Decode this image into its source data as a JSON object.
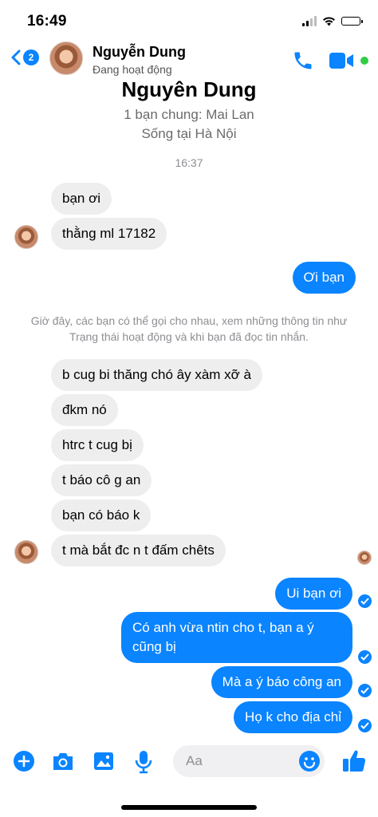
{
  "status_bar": {
    "time": "16:49"
  },
  "header": {
    "back_badge": "2",
    "name": "Nguyễn Dung",
    "status": "Đang hoạt động",
    "colors": {
      "accent": "#0a84ff",
      "online": "#31cc46"
    },
    "icons": [
      "back-chevron-icon",
      "phone-icon",
      "video-camera-icon"
    ]
  },
  "intro": {
    "name": "Nguyên Dung",
    "mutual": "1 bạn chung: Mai Lan",
    "location": "Sống tại Hà Nội"
  },
  "timestamp": "16:37",
  "messages_block1": [
    {
      "from": "them",
      "text": "bạn ơi"
    },
    {
      "from": "them",
      "text": "thằng ml 17182"
    },
    {
      "from": "me",
      "text": "Ơi bạn"
    }
  ],
  "notice": "Giờ đây, các bạn có thể gọi cho nhau, xem những thông tin như Trạng thái hoạt động và khi bạn đã đọc tin nhắn.",
  "messages_block2": [
    {
      "from": "them",
      "text": "b cug bi thăng chó ây xàm xỡ à"
    },
    {
      "from": "them",
      "text": "đkm nó"
    },
    {
      "from": "them",
      "text": "htrc t cug bị"
    },
    {
      "from": "them",
      "text": "t báo cô g an"
    },
    {
      "from": "them",
      "text": "bạn có báo k"
    },
    {
      "from": "them",
      "text": "t mà bắt đc n t đấm chêts"
    }
  ],
  "messages_block3": [
    {
      "from": "me",
      "text": "Ui bạn ơi"
    },
    {
      "from": "me",
      "text": "Có anh vừa ntin cho t, bạn a ý cũng bị"
    },
    {
      "from": "me",
      "text": "Mà a ý báo công an"
    },
    {
      "from": "me",
      "text": "Họ k cho địa chỉ"
    }
  ],
  "composer": {
    "placeholder": "Aa",
    "icons": [
      "plus-icon",
      "camera-icon",
      "photo-icon",
      "microphone-icon",
      "emoji-icon",
      "thumbs-up-icon"
    ]
  }
}
